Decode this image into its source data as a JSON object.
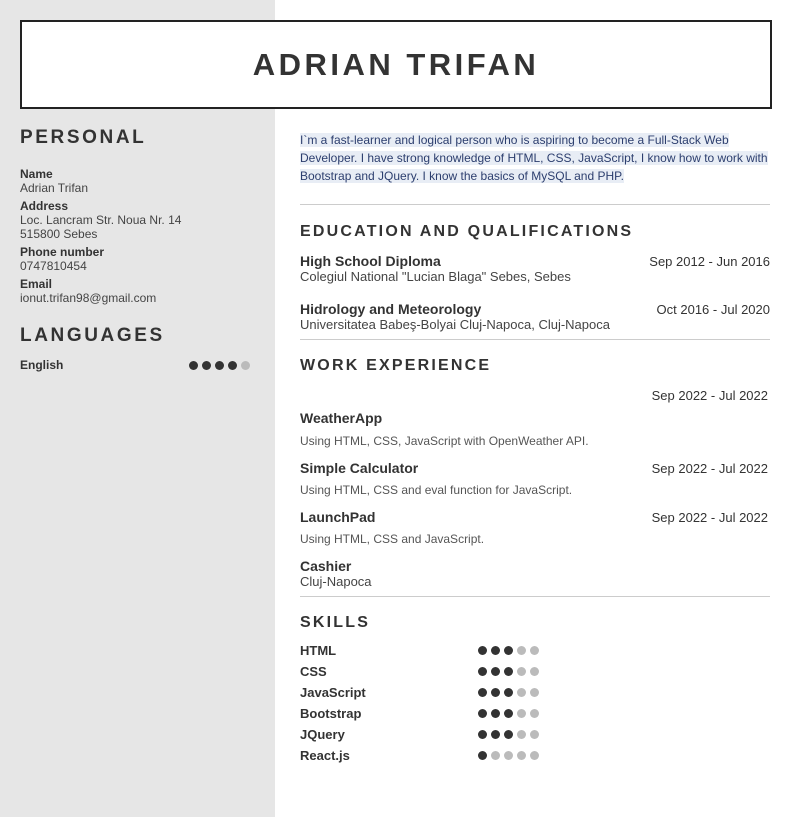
{
  "header": {
    "name": "ADRIAN TRIFAN"
  },
  "personal": {
    "title": "PERSONAL",
    "name_label": "Name",
    "name_value": "Adrian Trifan",
    "address_label": "Address",
    "address_line1": "Loc. Lancram Str. Noua Nr. 14",
    "address_line2": "515800 Sebes",
    "phone_label": "Phone number",
    "phone_value": "0747810454",
    "email_label": "Email",
    "email_value": "ionut.trifan98@gmail.com"
  },
  "languages": {
    "title": "LANGUAGES",
    "items": [
      {
        "name": "English",
        "level": 4,
        "max": 5
      }
    ]
  },
  "summary": "I`m a fast-learner and logical person who is aspiring to become a Full-Stack Web Developer. I have strong knowledge of HTML, CSS, JavaScript, I know how to work with Bootstrap and JQuery. I know the basics of MySQL and PHP.",
  "education": {
    "title": "EDUCATION AND QUALIFICATIONS",
    "items": [
      {
        "title": "High School Diploma",
        "institution": "Colegiul National \"Lucian Blaga\" Sebes, Sebes",
        "dates": "Sep 2012 - Jun 2016"
      },
      {
        "title": "Hidrology and Meteorology",
        "institution": "Universitatea Babeş-Bolyai Cluj-Napoca, Cluj-Napoca",
        "dates": "Oct 2016 - Jul 2020"
      }
    ]
  },
  "work": {
    "title": "WORK EXPERIENCE",
    "items": [
      {
        "title": "WeatherApp",
        "dates": "Sep 2022 - Jul 2022",
        "description": "Using HTML, CSS, JavaScript with OpenWeather API."
      },
      {
        "title": "Simple Calculator",
        "dates": "Sep 2022 - Jul 2022",
        "description": "Using HTML, CSS and eval function for JavaScript."
      },
      {
        "title": "LaunchPad",
        "dates": "Sep 2022 - Jul 2022",
        "description": "Using HTML, CSS and JavaScript."
      },
      {
        "title": "Cashier",
        "location": "Cluj-Napoca"
      }
    ]
  },
  "skills": {
    "title": "SKILLS",
    "max": 5,
    "items": [
      {
        "name": "HTML",
        "level": 3
      },
      {
        "name": "CSS",
        "level": 3
      },
      {
        "name": "JavaScript",
        "level": 3
      },
      {
        "name": "Bootstrap",
        "level": 3
      },
      {
        "name": "JQuery",
        "level": 3
      },
      {
        "name": "React.js",
        "level": 1
      }
    ]
  },
  "colors": {
    "sidebar": "#e6e6e6",
    "text": "#333333",
    "dot_filled": "#333333",
    "dot_empty": "#bbbbbb",
    "highlight": "#e8edf5"
  }
}
